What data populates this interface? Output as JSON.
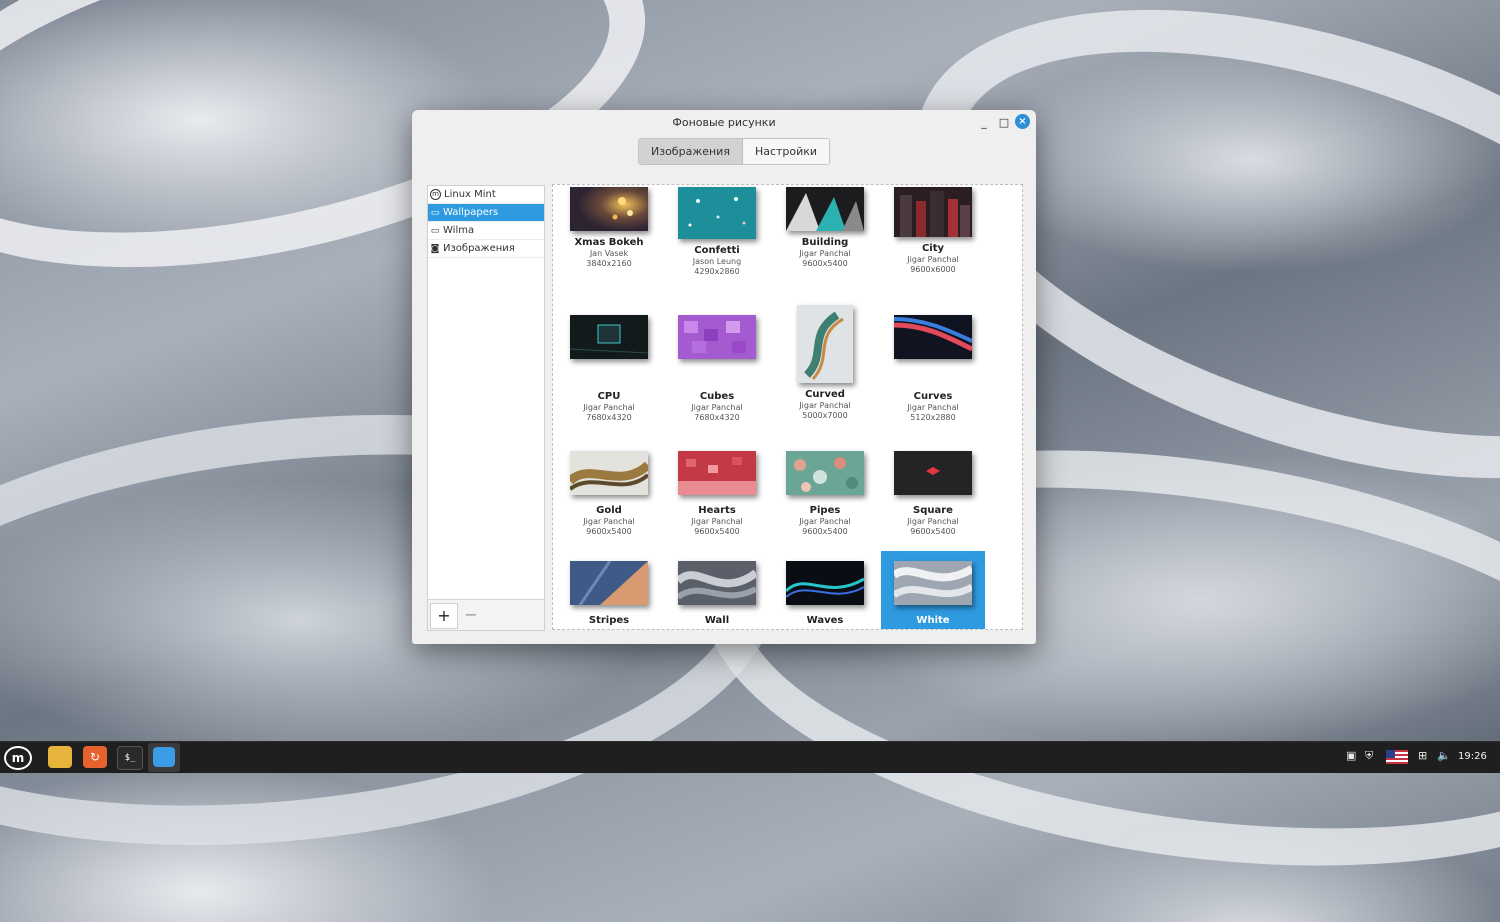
{
  "window": {
    "title": "Фоновые рисунки",
    "tabs": [
      {
        "label": "Изображения",
        "active": true
      },
      {
        "label": "Настройки",
        "active": false
      }
    ],
    "controls": {
      "minimize": "_",
      "maximize": "□",
      "close": "×"
    }
  },
  "sidebar": {
    "items": [
      {
        "label": "Linux Mint",
        "icon": "mint-logo-icon",
        "selected": false
      },
      {
        "label": "Wallpapers",
        "icon": "monitor-icon",
        "selected": true
      },
      {
        "label": "Wilma",
        "icon": "monitor-icon",
        "selected": false
      },
      {
        "label": "Изображения",
        "icon": "camera-icon",
        "selected": false
      }
    ],
    "add_label": "+",
    "remove_label": "−"
  },
  "wallpapers": [
    {
      "name": "Xmas Bokeh",
      "author": "Jan Vasek",
      "resolution": "3840x2160"
    },
    {
      "name": "Confetti",
      "author": "Jason Leung",
      "resolution": "4290x2860"
    },
    {
      "name": "Building",
      "author": "Jigar Panchal",
      "resolution": "9600x5400"
    },
    {
      "name": "City",
      "author": "Jigar Panchal",
      "resolution": "9600x6000"
    },
    {
      "name": "CPU",
      "author": "Jigar Panchal",
      "resolution": "7680x4320"
    },
    {
      "name": "Cubes",
      "author": "Jigar Panchal",
      "resolution": "7680x4320"
    },
    {
      "name": "Curved",
      "author": "Jigar Panchal",
      "resolution": "5000x7000"
    },
    {
      "name": "Curves",
      "author": "Jigar Panchal",
      "resolution": "5120x2880"
    },
    {
      "name": "Gold",
      "author": "Jigar Panchal",
      "resolution": "9600x5400"
    },
    {
      "name": "Hearts",
      "author": "Jigar Panchal",
      "resolution": "9600x5400"
    },
    {
      "name": "Pipes",
      "author": "Jigar Panchal",
      "resolution": "9600x5400"
    },
    {
      "name": "Square",
      "author": "Jigar Panchal",
      "resolution": "9600x5400"
    },
    {
      "name": "Stripes",
      "author": "",
      "resolution": ""
    },
    {
      "name": "Wall",
      "author": "",
      "resolution": ""
    },
    {
      "name": "Waves",
      "author": "",
      "resolution": ""
    },
    {
      "name": "White",
      "author": "",
      "resolution": "",
      "selected": true
    }
  ],
  "taskbar": {
    "apps": [
      "mint-menu-icon",
      "files-icon",
      "update-manager-icon",
      "terminal-icon",
      "wallpaper-app-icon"
    ],
    "tray": [
      "clipboard-icon",
      "shield-icon",
      "us-flag-icon",
      "network-icon",
      "volume-icon"
    ],
    "clock": "19:26"
  },
  "colors": {
    "accent": "#2e9ae0",
    "taskbar": "#1f1f1f"
  }
}
